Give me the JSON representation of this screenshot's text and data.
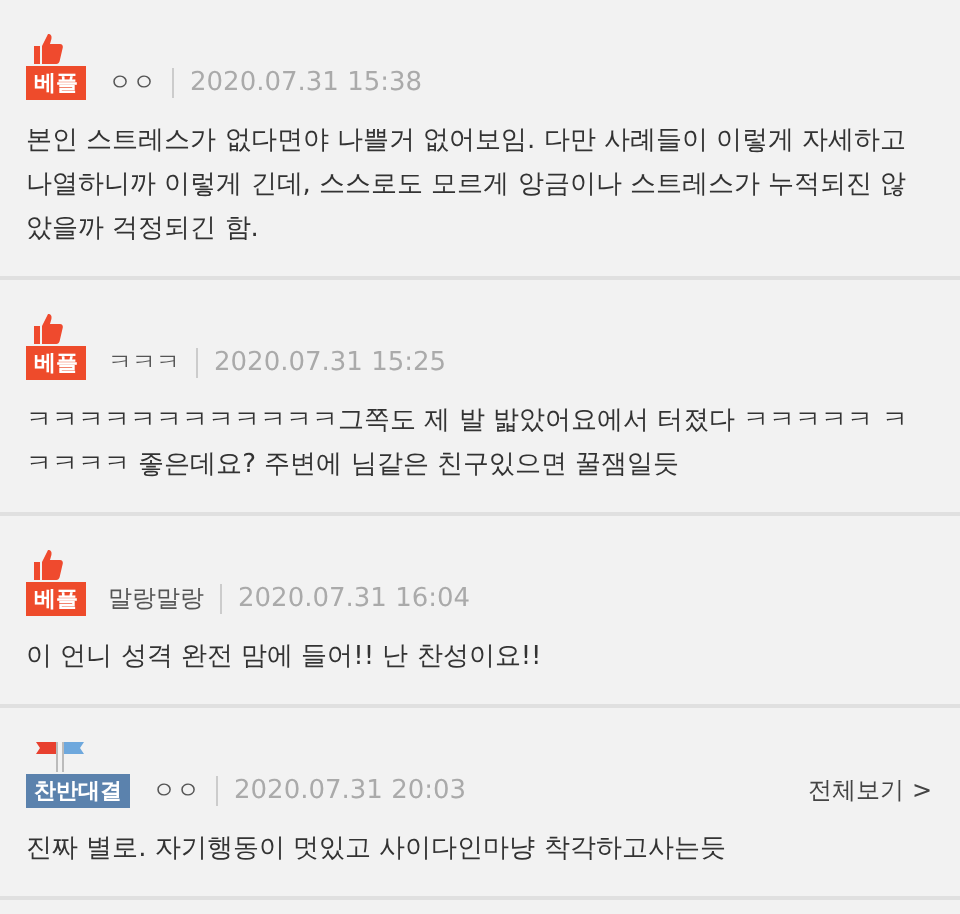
{
  "comments": [
    {
      "kind": "best",
      "badge": "베플",
      "author": "ㅇㅇ",
      "date": "2020.07.31 15:38",
      "body": "본인 스트레스가 없다면야 나쁠거 없어보임. 다만 사례들이 이렇게 자세하고 나열하니까 이렇게 긴데, 스스로도 모르게 앙금이나 스트레스가 누적되진 않았을까 걱정되긴 함."
    },
    {
      "kind": "best",
      "badge": "베플",
      "author": "ㅋㅋㅋ",
      "date": "2020.07.31 15:25",
      "body": "ㅋㅋㅋㅋㅋㅋㅋㅋㅋㅋㅋㅋ그쪽도 제 발 밟았어요에서 터졌다 ㅋㅋㅋㅋㅋ ㅋㅋㅋㅋㅋ 좋은데요? 주변에 님같은 친구있으면 꿀잼일듯"
    },
    {
      "kind": "best",
      "badge": "베플",
      "author": "말랑말랑",
      "date": "2020.07.31 16:04",
      "body": "이 언니 성격 완전 맘에 들어!! 난 찬성이요!!"
    },
    {
      "kind": "debate",
      "badge": "찬반대결",
      "author": "ㅇㅇ",
      "date": "2020.07.31 20:03",
      "more": "전체보기 >",
      "body": "진짜 별로. 자기행동이 멋있고 사이다인마냥 착각하고사는듯"
    }
  ]
}
